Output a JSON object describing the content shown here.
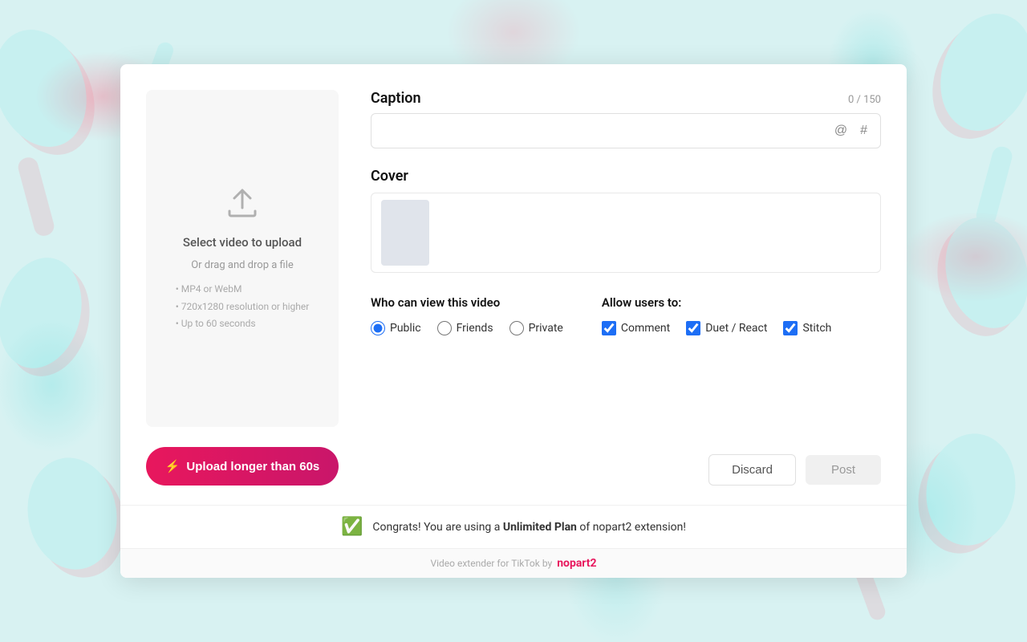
{
  "background": {
    "color": "#d0efef"
  },
  "modal": {
    "left_panel": {
      "upload_title": "Select video to upload",
      "upload_subtitle": "Or drag and drop a file",
      "specs": [
        "MP4 or WebM",
        "720x1280 resolution or higher",
        "Up to 60 seconds"
      ],
      "upload_btn_label": "Upload longer than ",
      "upload_btn_highlight": "60s",
      "upload_icon": "⬆"
    },
    "right_panel": {
      "caption_label": "Caption",
      "char_count": "0 / 150",
      "caption_placeholder": "",
      "caption_at_icon": "@",
      "caption_hash_icon": "#",
      "cover_label": "Cover",
      "view_label": "Who can view this video",
      "view_options": [
        {
          "id": "public",
          "label": "Public",
          "checked": true
        },
        {
          "id": "friends",
          "label": "Friends",
          "checked": false
        },
        {
          "id": "private",
          "label": "Private",
          "checked": false
        }
      ],
      "allow_label": "Allow users to:",
      "allow_options": [
        {
          "id": "comment",
          "label": "Comment",
          "checked": true
        },
        {
          "id": "duet_react",
          "label": "Duet / React",
          "checked": true
        },
        {
          "id": "stitch",
          "label": "Stitch",
          "checked": true
        }
      ],
      "discard_btn": "Discard",
      "post_btn": "Post"
    },
    "banner": {
      "badge": "✅",
      "text_before": "Congrats! You are using a ",
      "text_bold": "Unlimited Plan",
      "text_after": " of nopart2 extension!"
    },
    "footer": {
      "text": "Video extender for TikTok by",
      "logo": "nopart2"
    }
  }
}
